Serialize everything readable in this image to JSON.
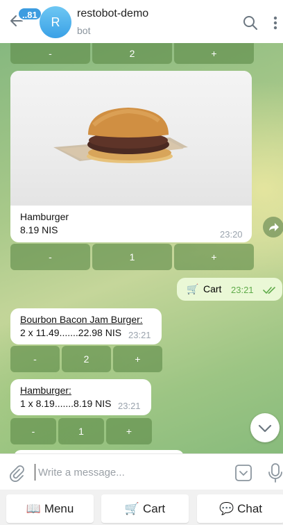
{
  "header": {
    "unread_count": "..81",
    "avatar_letter": "R",
    "title": "restobot-demo",
    "subtitle": "bot"
  },
  "chat": {
    "keyboard_top": [
      "-",
      "2",
      "+"
    ],
    "hamburger_card": {
      "name": "Hamburger",
      "price": "8.19 NIS",
      "time": "23:20"
    },
    "keyboard_hamburger": [
      "-",
      "1",
      "+"
    ],
    "outgoing": {
      "icon": "🛒",
      "text": "Cart",
      "time": "23:21"
    },
    "cart_item_1": {
      "title": "Bourbon Bacon Jam Burger:",
      "detail": "2 x 11.49.......22.98 NIS",
      "time": "23:21"
    },
    "keyboard_item_1": [
      "-",
      "2",
      "+"
    ],
    "cart_item_2": {
      "title": "Hamburger:",
      "detail": "1 x 8.19.......8.19 NIS",
      "time": "23:21"
    },
    "keyboard_item_2": [
      "-",
      "1",
      "+"
    ]
  },
  "composer": {
    "placeholder": "Write a message..."
  },
  "bot_keyboard": [
    {
      "icon": "📖",
      "label": "Menu"
    },
    {
      "icon": "🛒",
      "label": "Cart"
    },
    {
      "icon": "💬",
      "label": "Chat"
    }
  ]
}
